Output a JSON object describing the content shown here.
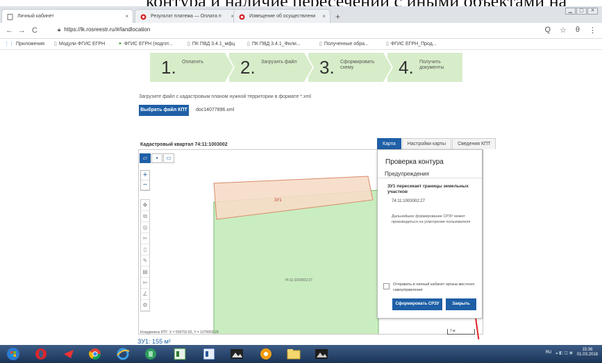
{
  "doc_overlay": "контура и наличие пересечений с иными объектами на",
  "browser": {
    "tabs": [
      {
        "title": "Личный кабинет",
        "close": "×"
      },
      {
        "title": "Результат платежа — Оплата п",
        "close": "×"
      },
      {
        "title": "Извещение об осуществлени",
        "close": "×"
      }
    ],
    "new_tab": "+",
    "url": "https://lk.rosreestr.ru/#/landlocation",
    "nav": {
      "back": "←",
      "forward": "→",
      "reload": "C"
    },
    "tools": {
      "zoom": "Q",
      "star": "☆",
      "account": "θ",
      "menu": "⋮"
    }
  },
  "bookmarks": [
    {
      "label": "Приложения",
      "icon": "⋮⋮"
    },
    {
      "label": "Модули ФГИС ЕГРН",
      "icon": "▯"
    },
    {
      "label": "ФГИС ЕГРН (подгот...",
      "icon": "✦"
    },
    {
      "label": "ПК ПВД 3.4.1_мфц",
      "icon": "▯"
    },
    {
      "label": "ПК ПВД 3.4.1_Фили...",
      "icon": "▯"
    },
    {
      "label": "Полученные обра...",
      "icon": "▯"
    },
    {
      "label": "ФГИС ЕГРН_Прод...",
      "icon": "▯"
    }
  ],
  "steps": [
    {
      "num": "1.",
      "label": "Оплатить"
    },
    {
      "num": "2.",
      "label": "Загрузить файл"
    },
    {
      "num": "3.",
      "label": "Сформировать схему"
    },
    {
      "num": "4.",
      "label": "Получить документы"
    }
  ],
  "upload": {
    "instruction": "Загрузите файл с кадастровым планом нужной территории в формате *.xml",
    "button": "Выбрать файл КПТ",
    "filename": "doc14077896.xml"
  },
  "map": {
    "title": "Кадастровый квартал 74:11:1003002",
    "tabs": [
      "Карта",
      "Настройки карты",
      "Сведения КПТ"
    ],
    "parcel_label": "ЗУ1",
    "existing_label": "74:11:1003002:27",
    "coords": "Координаты КПТ: X = 559792.83, Y = 1079659.29",
    "area": "ЗУ1: 155 м²",
    "scale": "7 м",
    "zoom_in": "+",
    "zoom_out": "−",
    "colors": {
      "new_parcel": "#f6dcc8",
      "existing_parcel": "#c9edc0",
      "accent": "#1e5fa6"
    }
  },
  "panel": {
    "title": "Проверка контура",
    "section": "Предупреждения",
    "warning": "ЗУ1 пересекает границы земельных участков",
    "cad_number": "74:11:1003002:27",
    "note": "Дальнейшее формирование СРЗУ может производиться на усмотрение пользователя",
    "checkbox_label": "Отправить в личный кабинет органа местного самоуправления",
    "submit_button": "Сформировать СРЗУ",
    "close_button": "Закрыть"
  },
  "taskbar": {
    "lang": "RU",
    "time": "15:36",
    "date": "01.03.2018"
  }
}
